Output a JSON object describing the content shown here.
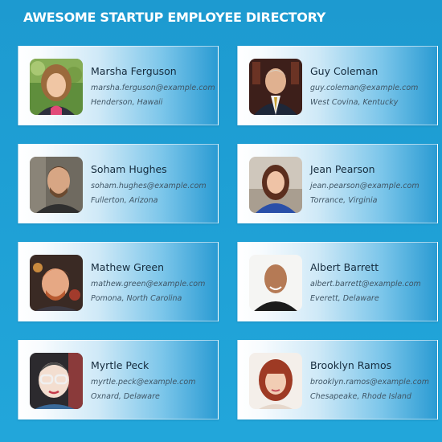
{
  "page": {
    "title": "AWESOME STARTUP EMPLOYEE DIRECTORY"
  },
  "employees": [
    {
      "name": "Marsha Ferguson",
      "email": "marsha.ferguson@example.com",
      "location": "Henderson, Hawaii"
    },
    {
      "name": "Guy Coleman",
      "email": "guy.coleman@example.com",
      "location": "West Covina, Kentucky"
    },
    {
      "name": "Soham Hughes",
      "email": "soham.hughes@example.com",
      "location": "Fullerton, Arizona"
    },
    {
      "name": "Jean Pearson",
      "email": "jean.pearson@example.com",
      "location": "Torrance, Virginia"
    },
    {
      "name": "Mathew Green",
      "email": "mathew.green@example.com",
      "location": "Pomona, North Carolina"
    },
    {
      "name": "Albert Barrett",
      "email": "albert.barrett@example.com",
      "location": "Everett, Delaware"
    },
    {
      "name": "Myrtle Peck",
      "email": "myrtle.peck@example.com",
      "location": "Oxnard, Delaware"
    },
    {
      "name": "Brooklyn Ramos",
      "email": "brooklyn.ramos@example.com",
      "location": "Chesapeake, Rhode Island"
    }
  ],
  "colors": {
    "background": "#1fa1d6",
    "title": "#ffffff",
    "name_text": "#152b3d",
    "detail_text": "#3f5565"
  }
}
